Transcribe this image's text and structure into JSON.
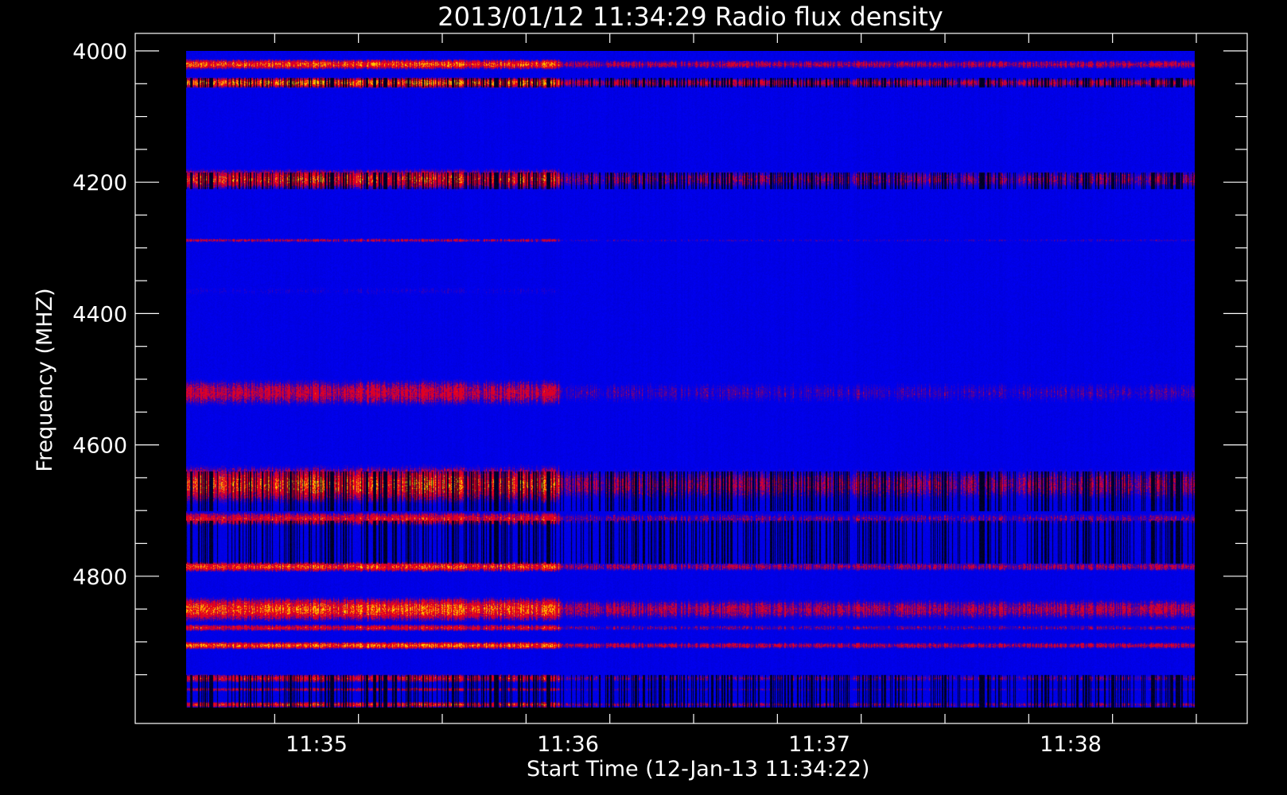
{
  "chart_data": {
    "type": "heatmap",
    "title": "2013/01/12 11:34:29 Radio flux density",
    "xlabel": "Start Time (12-Jan-13 11:34:22)",
    "ylabel": "Frequency (MHZ)",
    "ylim": [
      4000,
      5000
    ],
    "y_inverted": true,
    "y_ticks": [
      4000,
      4200,
      4400,
      4600,
      4800
    ],
    "y_tick_labels": [
      "4000",
      "4200",
      "4400",
      "4600",
      "4800"
    ],
    "x_ticks": [
      "11:35",
      "11:36",
      "11:37",
      "11:38"
    ],
    "x_minor_tick_seconds": 20,
    "colors": {
      "background": "#000000",
      "axis": "#ffffff",
      "low": "#0000ff",
      "mid": "#ff0000",
      "high": "#ffff99",
      "void": "#000000"
    },
    "bright_bands_mhz": [
      {
        "center": 4020,
        "width": 14,
        "intensity": 0.8
      },
      {
        "center": 4048,
        "width": 14,
        "intensity": 0.9
      },
      {
        "center": 4195,
        "width": 28,
        "intensity": 0.7
      },
      {
        "center": 4288,
        "width": 6,
        "intensity": 0.45
      },
      {
        "center": 4365,
        "width": 20,
        "intensity": 0.2
      },
      {
        "center": 4520,
        "width": 40,
        "intensity": 0.5
      },
      {
        "center": 4660,
        "width": 50,
        "intensity": 0.75
      },
      {
        "center": 4712,
        "width": 20,
        "intensity": 0.6
      },
      {
        "center": 4785,
        "width": 14,
        "intensity": 0.75
      },
      {
        "center": 4850,
        "width": 32,
        "intensity": 0.8
      },
      {
        "center": 4878,
        "width": 10,
        "intensity": 0.6
      },
      {
        "center": 4905,
        "width": 10,
        "intensity": 0.85
      },
      {
        "center": 4955,
        "width": 12,
        "intensity": 0.6
      },
      {
        "center": 4972,
        "width": 6,
        "intensity": 0.5
      },
      {
        "center": 4995,
        "width": 8,
        "intensity": 0.7
      }
    ]
  }
}
